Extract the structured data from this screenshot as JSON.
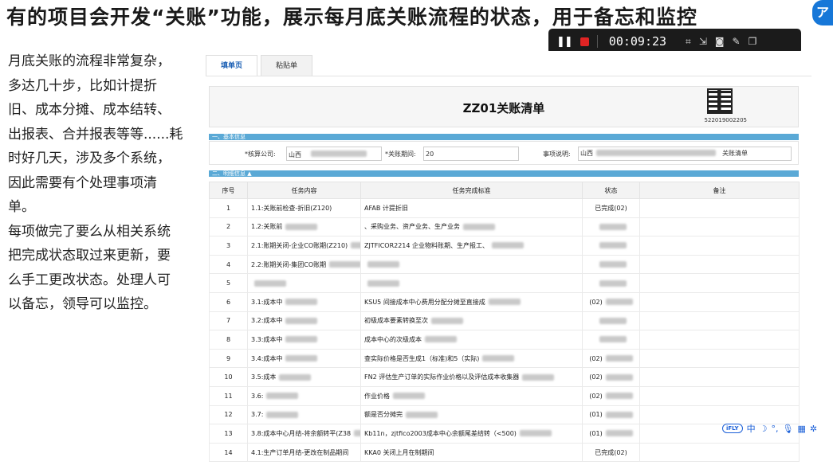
{
  "slide": {
    "title": "有的项目会开发“关账”功能，展示每月底关账流程的状态，用于备忘和监控",
    "paragraphs": [
      "月底关账的流程非常复杂，多达几十步，比如计提折旧、成本分摊、成本结转、出报表、合并报表等等......耗时好几天，涉及多个系统，因此需要有个处理事项清单。",
      "每项做完了要么从相关系统把完成状态取过来更新，要么手工更改状态。处理人可以备忘，领导可以监控。"
    ]
  },
  "recorder": {
    "time": "00:09:23"
  },
  "tabs": [
    {
      "label": "填单页"
    },
    {
      "label": "粘贴单"
    }
  ],
  "doc": {
    "title": "ZZ01关账清单",
    "barcode_number": "522019002205"
  },
  "sections": {
    "basic": "一、基本信息",
    "detail": "二、明细信息"
  },
  "basic_info": {
    "company_label": "*核算公司:",
    "company_value": "山西",
    "period_label": "*关账期间:",
    "period_value": "20",
    "desc_label": "事项说明:",
    "desc_value": "山西",
    "desc_suffix": "关账清单"
  },
  "table": {
    "headers": [
      "序号",
      "任务内容",
      "任务完成标准",
      "状态",
      "备注"
    ],
    "rows": [
      {
        "seq": "1",
        "task": "1.1:关账前检查-折旧(Z120)",
        "std": "AFAB 计提折旧",
        "status": "已完成(02)"
      },
      {
        "seq": "2",
        "task": "1.2:关账前",
        "std": "、采购业务、资产业务、生产业务",
        "status": ""
      },
      {
        "seq": "3",
        "task": "2.1:账期关闭-企业CO账期(Z210)",
        "std": "ZJTFICOR2214 企业物料账期、生产报工、",
        "status": ""
      },
      {
        "seq": "4",
        "task": "2.2:账期关闭-集团CO账期",
        "std": "",
        "status": ""
      },
      {
        "seq": "5",
        "task": "",
        "std": "",
        "status": ""
      },
      {
        "seq": "6",
        "task": "3.1:成本中",
        "std": "KSU5 间接成本中心费用分配分摊至直接成",
        "status": "(02)"
      },
      {
        "seq": "7",
        "task": "3.2:成本中",
        "std": "初级成本要素转换至次",
        "status": ""
      },
      {
        "seq": "8",
        "task": "3.3:成本中",
        "std": "成本中心的次级成本",
        "status": ""
      },
      {
        "seq": "9",
        "task": "3.4:成本中",
        "std": "查实际价格是否生成1（标准)和5（实际)",
        "status": "(02)"
      },
      {
        "seq": "10",
        "task": "3.5:成本",
        "std": "FN2 评估生产订单的实际作业价格以及评估成本收集器",
        "status": "(02)"
      },
      {
        "seq": "11",
        "task": "3.6:",
        "std": "作业价格",
        "status": "(02)"
      },
      {
        "seq": "12",
        "task": "3.7:",
        "std": "额是否分摊完",
        "status": "(01)"
      },
      {
        "seq": "13",
        "task": "3.8:成本中心月结-将余额转平(Z38",
        "std": "Kb11n，zjtfico2003成本中心余额尾差结转（<500)",
        "status": "(01)"
      },
      {
        "seq": "14",
        "task": "4.1:生产订单月结-更改在制品期间",
        "std": "KKA0 关闭上月在制期间",
        "status": "已完成(02)"
      }
    ]
  },
  "ifly": {
    "logo": "iFLY",
    "lang": "中"
  }
}
